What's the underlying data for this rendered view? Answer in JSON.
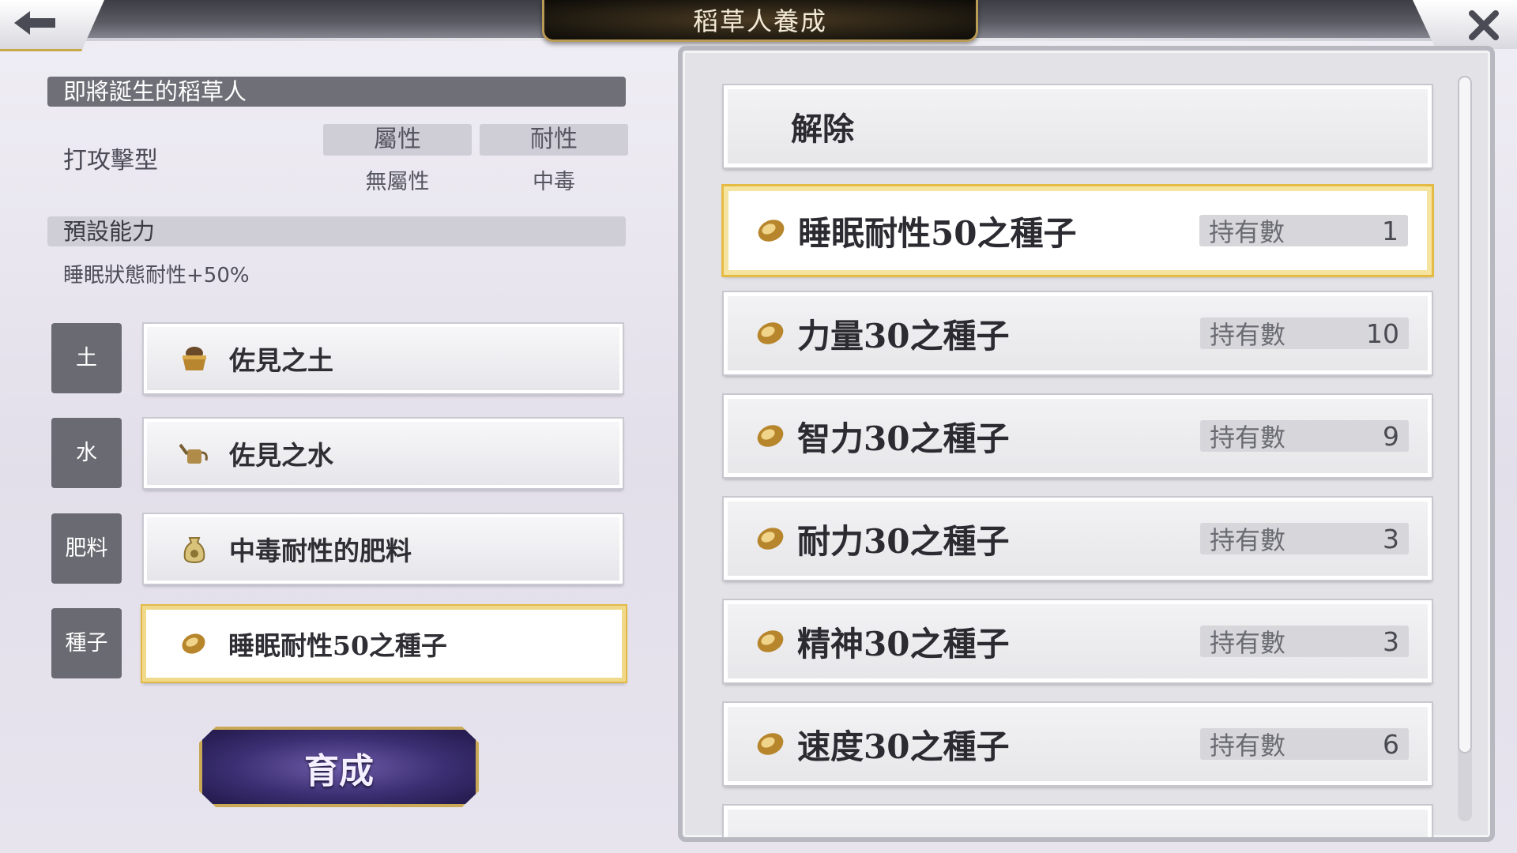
{
  "header": {
    "title": "稻草人養成",
    "back_icon": "arrow-left-icon",
    "close_icon": "close-icon"
  },
  "left": {
    "upcoming_title": "即將誕生的稻草人",
    "type_label": "打攻擊型",
    "attr_head": "屬性",
    "attr_value": "無屬性",
    "resist_head": "耐性",
    "resist_value": "中毒",
    "default_ability_title": "預設能力",
    "default_ability_text": "睡眠狀態耐性+50%",
    "slots": [
      {
        "tag": "土",
        "item": "佐見之土",
        "icon": "soil-pot-icon"
      },
      {
        "tag": "水",
        "item": "佐見之水",
        "icon": "watering-can-icon"
      },
      {
        "tag": "肥料",
        "item": "中毒耐性的肥料",
        "icon": "fertilizer-bag-icon"
      },
      {
        "tag": "種子",
        "item": "睡眠耐性50之種子",
        "icon": "seed-icon"
      }
    ],
    "grow_button": "育成"
  },
  "right": {
    "clear_label": "解除",
    "count_label": "持有數",
    "items": [
      {
        "name": "睡眠耐性50之種子",
        "count": "1"
      },
      {
        "name": "力量30之種子",
        "count": "10"
      },
      {
        "name": "智力30之種子",
        "count": "9"
      },
      {
        "name": "耐力30之種子",
        "count": "3"
      },
      {
        "name": "精神30之種子",
        "count": "3"
      },
      {
        "name": "速度30之種子",
        "count": "6"
      }
    ]
  },
  "colors": {
    "selected_border": "#e6bb43",
    "tag_bg": "#6a6a72",
    "grow_button_bg": "#3b2f72"
  }
}
